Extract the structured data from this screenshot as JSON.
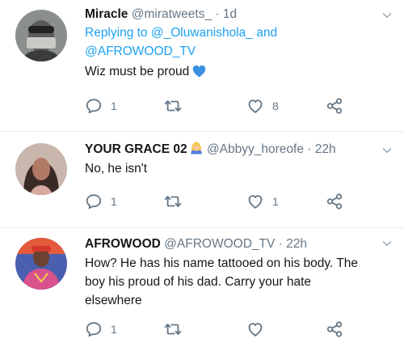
{
  "tweets": [
    {
      "name": "Miracle",
      "handle": "@miratweets_",
      "dot": "·",
      "time": "1d",
      "reply_lead": "Replying to",
      "reply_user1": "@_Oluwanishola_",
      "reply_and": "and",
      "reply_user2": "@AFROWOOD_TV",
      "text": "Wiz must be proud",
      "emoji": "blue-heart",
      "replies": "1",
      "retweets": "",
      "likes": "8"
    },
    {
      "name": "YOUR GRACE 02",
      "emoji": "person-with-blond-hair",
      "handle": "@Abbyy_horeofe",
      "dot": "·",
      "time": "22h",
      "text": "No, he isn't",
      "replies": "1",
      "retweets": "",
      "likes": "1"
    },
    {
      "name": "AFROWOOD",
      "handle": "@AFROWOOD_TV",
      "dot": "·",
      "time": "22h",
      "text_lines": [
        "How? He has his name tattooed on his body. The",
        "boy his proud of his dad. Carry your hate",
        "elsewhere"
      ],
      "replies": "1",
      "retweets": "",
      "likes": ""
    }
  ],
  "colors": {
    "accent": "#1da1f2",
    "muted": "#657786",
    "text": "#14171a",
    "heart": "#3b8fe0"
  },
  "icons": [
    "reply-icon",
    "retweet-icon",
    "like-icon",
    "share-icon",
    "caret-down-icon"
  ]
}
